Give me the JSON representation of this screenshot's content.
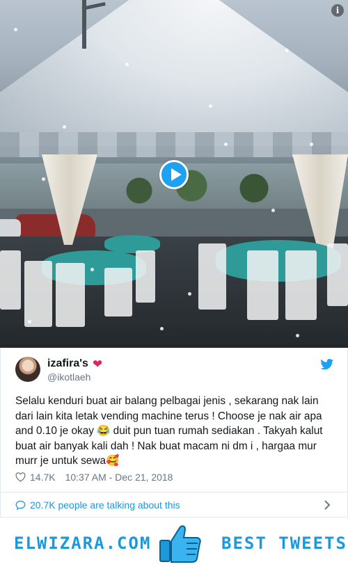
{
  "tweet": {
    "display_name": "izafira's",
    "handle": "@ikotlaeh",
    "text": "Selalu kenduri buat air balang pelbagai jenis , sekarang nak lain dari lain kita letak vending machine terus ! Choose je nak air apa and 0.10 je okay 😂 duit pun tuan rumah sediakan . Takyah kalut buat air banyak kali dah ! Nak buat macam ni dm i , hargaa mur murr je untuk sewa🥰",
    "likes": "14.7K",
    "timestamp": "10:37 AM - Dec 21, 2018",
    "talking": "20.7K people are talking about this"
  },
  "footer": {
    "left": "ELWIZARA.COM",
    "right": "BEST TWEETS"
  },
  "icons": {
    "info": "info-icon",
    "play": "play-icon",
    "bird": "twitter-bird-icon",
    "heart": "heart-icon",
    "bubble": "speech-bubble-icon",
    "chevron": "chevron-right-icon",
    "thumb": "thumbs-up-icon"
  },
  "colors": {
    "accent": "#1da1f2",
    "link": "#1b95e0",
    "brand_footer": "#1d98d8",
    "heart": "#e0245e",
    "muted": "#657786"
  }
}
